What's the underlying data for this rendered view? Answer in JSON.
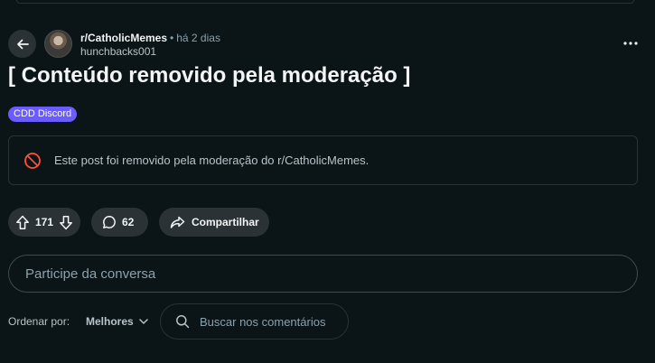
{
  "post": {
    "subreddit": "r/CatholicMemes",
    "separator": "•",
    "age": "há 2 dias",
    "author": "hunchbacks001",
    "title": "[ Conteúdo removido pela moderação ]",
    "flair": "CDD Discord",
    "removed_notice": "Este post foi removido pela moderação do r/CatholicMemes."
  },
  "actions": {
    "score": "171",
    "comments": "62",
    "share_label": "Compartilhar"
  },
  "comment_input": {
    "placeholder": "Participe da conversa"
  },
  "sort": {
    "label": "Ordenar por:",
    "selected": "Melhores"
  },
  "comment_search": {
    "placeholder": "Buscar nos comentários"
  },
  "icons": {
    "back": "arrow-left-icon",
    "more": "more-horizontal-icon",
    "removed": "ban-icon",
    "upvote": "arrow-up-icon",
    "downvote": "arrow-down-icon",
    "comment": "speech-bubble-icon",
    "share": "share-arrow-icon",
    "sort_caret": "chevron-down-icon",
    "search": "search-icon"
  },
  "colors": {
    "background": "#0b1416",
    "pill": "#2a3236",
    "flair": "#6a5cff",
    "removed_icon": "#ff4f3a",
    "muted_text": "#8ba2ad"
  }
}
